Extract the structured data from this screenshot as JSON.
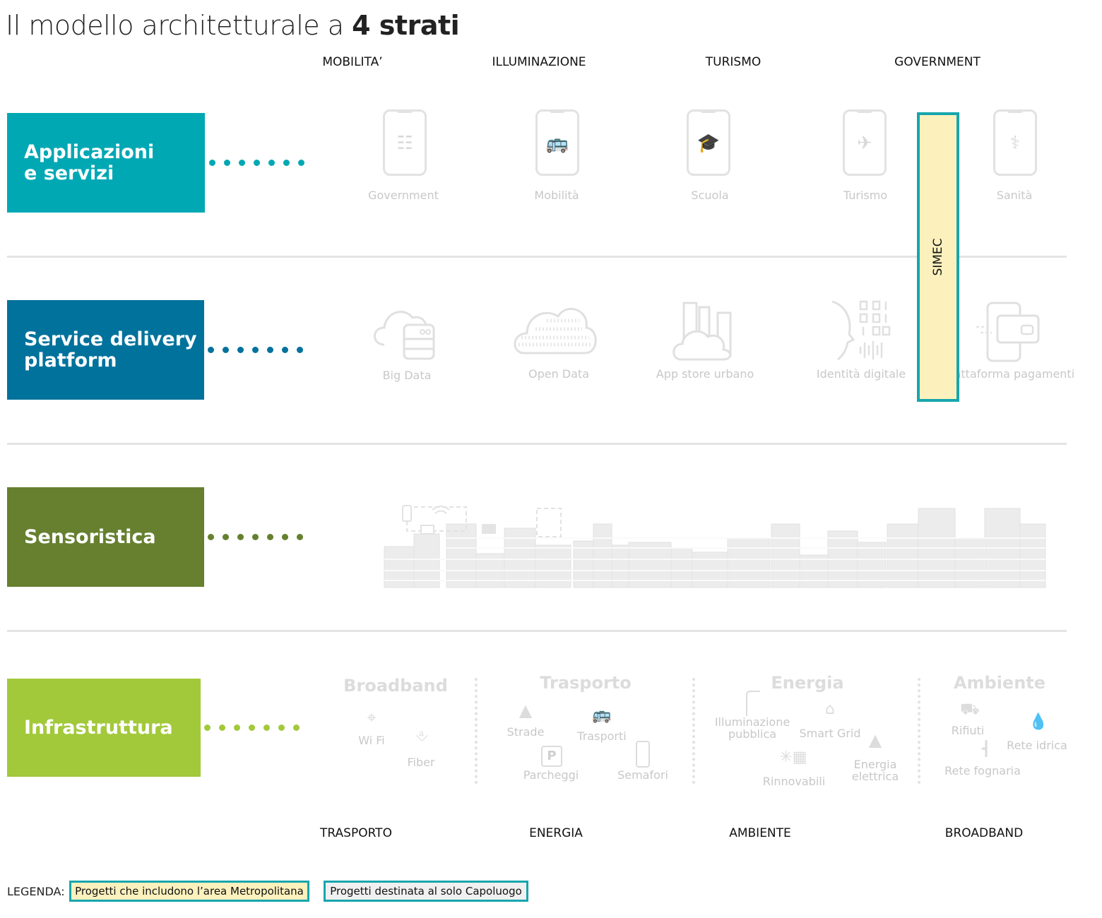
{
  "title": {
    "main": "Il modello architetturale a ",
    "bold": "4 strati"
  },
  "top_columns": [
    "MOBILITA’",
    "ILLUMINAZIONE",
    "TURISMO",
    "GOVERNMENT"
  ],
  "layers": [
    {
      "label_line1": "Applicazioni",
      "label_line2": "e servizi",
      "color": "#00a8b4"
    },
    {
      "label_line1": "Service delivery",
      "label_line2": "platform",
      "color": "#00729c"
    },
    {
      "label_line1": "Sensoristica",
      "label_line2": "",
      "color": "#66802f"
    },
    {
      "label_line1": "Infrastruttura",
      "label_line2": "",
      "color": "#a2c93a"
    }
  ],
  "applications": [
    {
      "label": "Government",
      "icon": "columns-icon"
    },
    {
      "label": "Mobilità",
      "icon": "bus-icon"
    },
    {
      "label": "Scuola",
      "icon": "school-icon"
    },
    {
      "label": "Turismo",
      "icon": "airplane-icon"
    },
    {
      "label": "Sanità",
      "icon": "caduceus-icon"
    }
  ],
  "platforms": [
    {
      "label": "Big Data",
      "icon": "cloud-database-icon"
    },
    {
      "label": "Open Data",
      "icon": "binary-cloud-icon"
    },
    {
      "label": "App store urbano",
      "icon": "city-cloud-icon"
    },
    {
      "label": "Identità digitale",
      "icon": "digital-identity-icon"
    },
    {
      "label": "Piattaforma pagamenti",
      "icon": "payment-icon"
    }
  ],
  "simec": {
    "label": "SIMEC",
    "fill": "#fcf1bd",
    "border": "#17a6ad"
  },
  "infrastructure": {
    "broadband": {
      "title": "Broadband",
      "items": [
        "Wi Fi",
        "Fiber"
      ]
    },
    "trasporto": {
      "title": "Trasporto",
      "items": [
        "Strade",
        "Trasporti",
        "Parcheggi",
        "Semafori"
      ]
    },
    "energia": {
      "title": "Energia",
      "items": [
        "Illuminazione",
        "pubblica",
        "Smart Grid",
        "Rinnovabili",
        "Energia",
        "elettrica"
      ]
    },
    "ambiente": {
      "title": "Ambiente",
      "items": [
        "Rifiuti",
        "Rete idrica",
        "Rete fognaria"
      ]
    }
  },
  "bottom_columns": [
    "TRASPORTO",
    "ENERGIA",
    "AMBIENTE",
    "BROADBAND"
  ],
  "legend": {
    "label": "LEGENDA:",
    "items": [
      {
        "text": "Progetti che includono l’area Metropolitana",
        "fill": "#fcf1bd"
      },
      {
        "text": "Progetti destinata al solo Capoluogo",
        "fill": "#f0f0f0"
      }
    ]
  }
}
